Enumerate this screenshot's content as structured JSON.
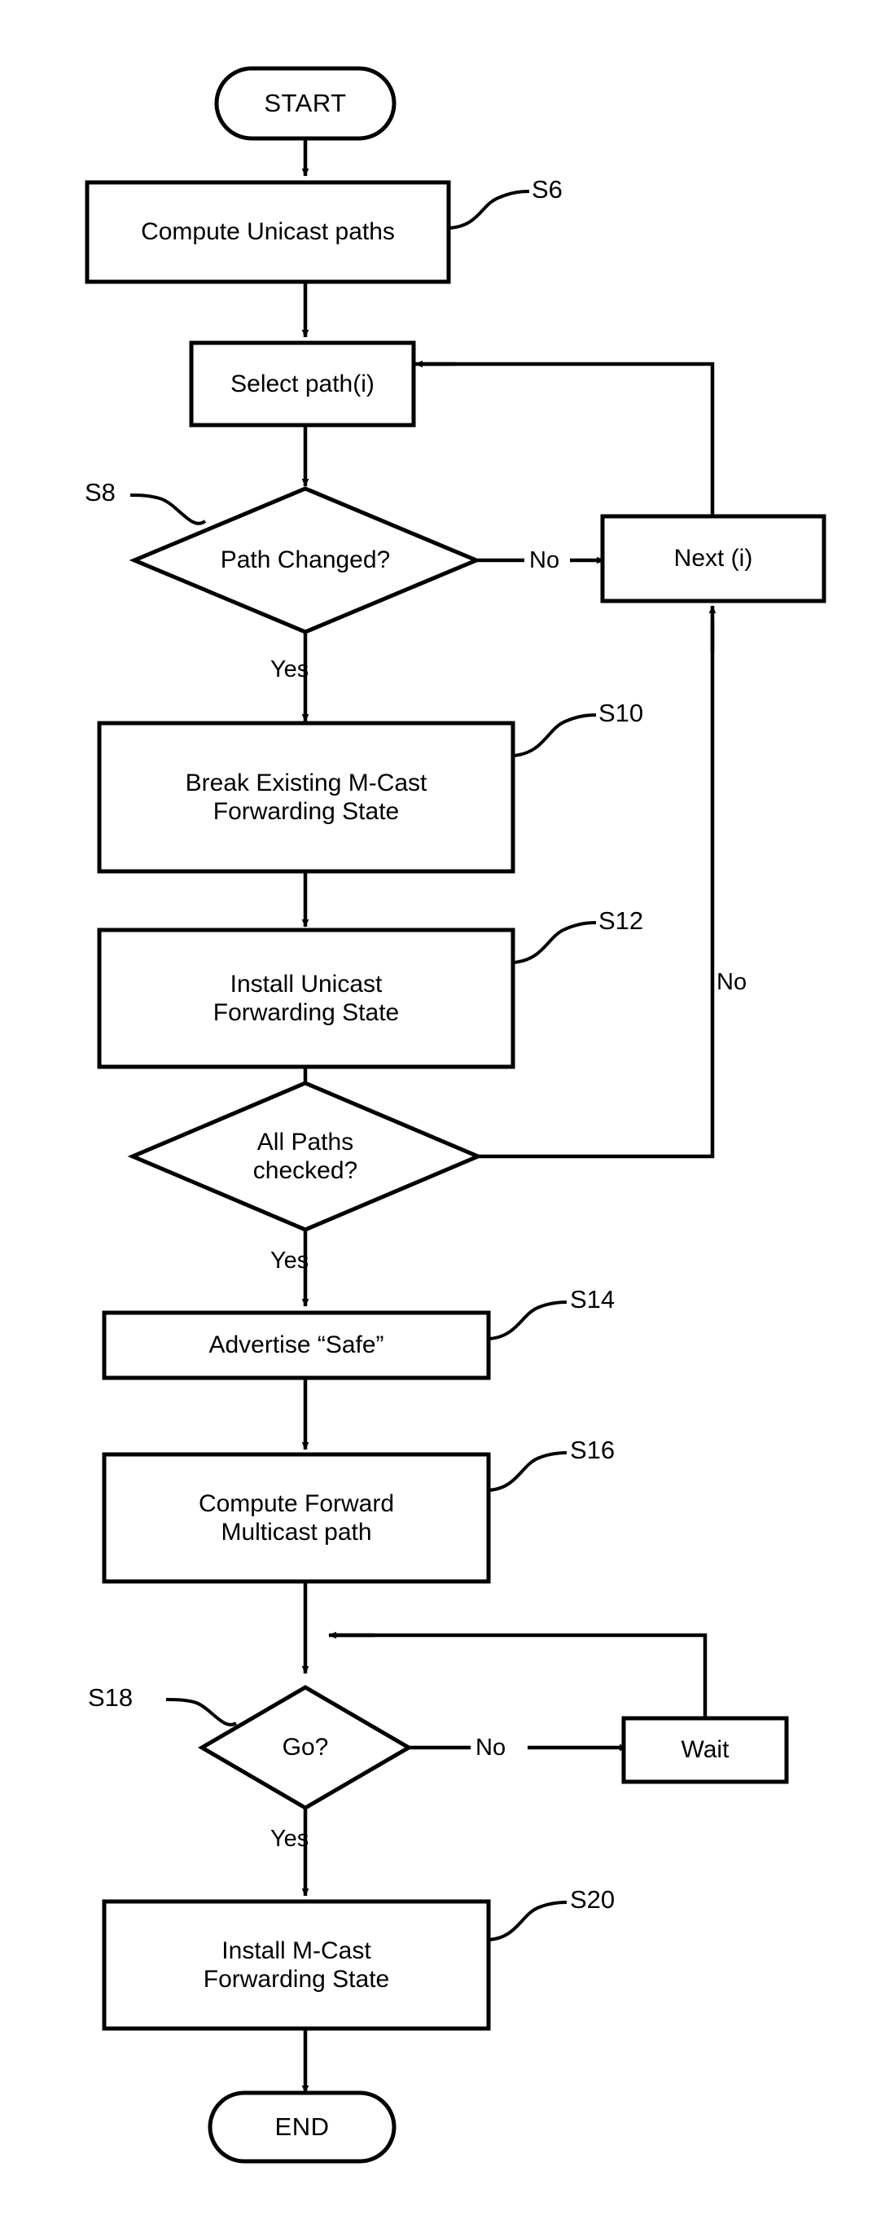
{
  "diagram": {
    "type": "flowchart",
    "title": "",
    "nodes": {
      "start": {
        "label": "START",
        "shape": "terminator"
      },
      "s6": {
        "label": "Compute Unicast paths",
        "shape": "process",
        "step": "S6"
      },
      "select_path": {
        "label": "Select path(i)",
        "shape": "process"
      },
      "s8": {
        "label": "Path Changed?",
        "shape": "decision",
        "step": "S8"
      },
      "next_i": {
        "label": "Next (i)",
        "shape": "process"
      },
      "s10": {
        "label": "Break Existing  M-Cast\nForwarding State",
        "shape": "process",
        "step": "S10"
      },
      "s12": {
        "label": "Install Unicast\nForwarding State",
        "shape": "process",
        "step": "S12"
      },
      "all_paths": {
        "label": "All Paths\nchecked?",
        "shape": "decision"
      },
      "s14": {
        "label": "Advertise “Safe”",
        "shape": "process",
        "step": "S14"
      },
      "s16": {
        "label": "Compute Forward\nMulticast path",
        "shape": "process",
        "step": "S16"
      },
      "s18": {
        "label": "Go?",
        "shape": "decision",
        "step": "S18"
      },
      "wait": {
        "label": "Wait",
        "shape": "process"
      },
      "s20": {
        "label": "Install M-Cast\nForwarding State",
        "shape": "process",
        "step": "S20"
      },
      "end": {
        "label": "END",
        "shape": "terminator"
      }
    },
    "edge_labels": {
      "path_changed_no": "No",
      "path_changed_yes": "Yes",
      "all_paths_no": "No",
      "all_paths_yes": "Yes",
      "go_no": "No",
      "go_yes": "Yes"
    },
    "step_labels": {
      "s6": "S6",
      "s8": "S8",
      "s10": "S10",
      "s12": "S12",
      "s14": "S14",
      "s16": "S16",
      "s18": "S18",
      "s20": "S20"
    },
    "colors": {
      "stroke": "#000000",
      "fill": "#ffffff",
      "background": "#ffffff"
    }
  }
}
